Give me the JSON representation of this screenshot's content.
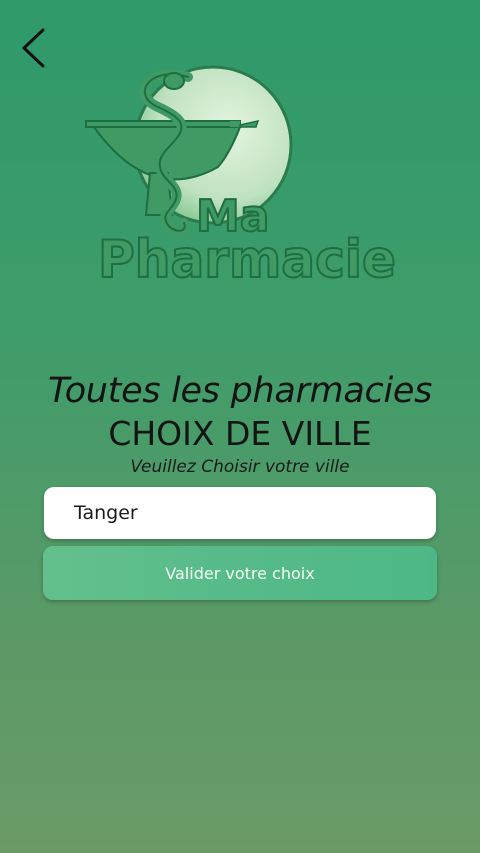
{
  "header": {
    "back_icon": "chevron-left-icon"
  },
  "logo": {
    "line1": "Ma",
    "line2": "Pharmacie",
    "icon": "caduceus-bowl-icon",
    "colors": {
      "fill": "#3f9a63",
      "outline": "#1e6e43",
      "circle": "#c4e5c4"
    }
  },
  "main": {
    "title_italic": "Toutes les pharmacies",
    "title": "CHOIX DE VILLE",
    "subtitle": "Veuillez Choisir votre ville",
    "city_select": {
      "value": "Tanger"
    },
    "submit_label": "Valider votre choix"
  },
  "colors": {
    "background_top": "#2f9a6a",
    "background_bottom": "#6a9a66",
    "button": "#56bb89"
  }
}
